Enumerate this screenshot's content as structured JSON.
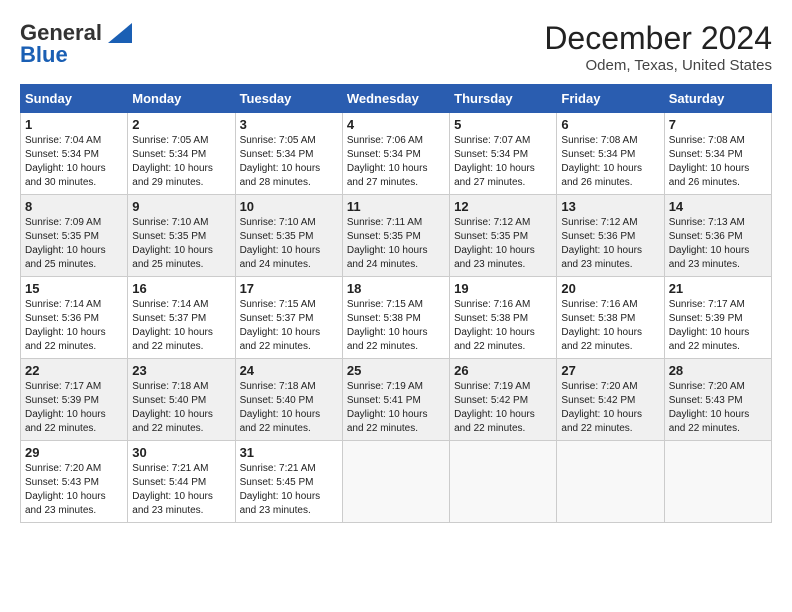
{
  "logo": {
    "line1": "General",
    "line2": "Blue"
  },
  "title": "December 2024",
  "location": "Odem, Texas, United States",
  "days_of_week": [
    "Sunday",
    "Monday",
    "Tuesday",
    "Wednesday",
    "Thursday",
    "Friday",
    "Saturday"
  ],
  "weeks": [
    [
      {
        "day": "1",
        "sunrise": "7:04 AM",
        "sunset": "5:34 PM",
        "daylight": "10 hours and 30 minutes."
      },
      {
        "day": "2",
        "sunrise": "7:05 AM",
        "sunset": "5:34 PM",
        "daylight": "10 hours and 29 minutes."
      },
      {
        "day": "3",
        "sunrise": "7:05 AM",
        "sunset": "5:34 PM",
        "daylight": "10 hours and 28 minutes."
      },
      {
        "day": "4",
        "sunrise": "7:06 AM",
        "sunset": "5:34 PM",
        "daylight": "10 hours and 27 minutes."
      },
      {
        "day": "5",
        "sunrise": "7:07 AM",
        "sunset": "5:34 PM",
        "daylight": "10 hours and 27 minutes."
      },
      {
        "day": "6",
        "sunrise": "7:08 AM",
        "sunset": "5:34 PM",
        "daylight": "10 hours and 26 minutes."
      },
      {
        "day": "7",
        "sunrise": "7:08 AM",
        "sunset": "5:34 PM",
        "daylight": "10 hours and 26 minutes."
      }
    ],
    [
      {
        "day": "8",
        "sunrise": "7:09 AM",
        "sunset": "5:35 PM",
        "daylight": "10 hours and 25 minutes."
      },
      {
        "day": "9",
        "sunrise": "7:10 AM",
        "sunset": "5:35 PM",
        "daylight": "10 hours and 25 minutes."
      },
      {
        "day": "10",
        "sunrise": "7:10 AM",
        "sunset": "5:35 PM",
        "daylight": "10 hours and 24 minutes."
      },
      {
        "day": "11",
        "sunrise": "7:11 AM",
        "sunset": "5:35 PM",
        "daylight": "10 hours and 24 minutes."
      },
      {
        "day": "12",
        "sunrise": "7:12 AM",
        "sunset": "5:35 PM",
        "daylight": "10 hours and 23 minutes."
      },
      {
        "day": "13",
        "sunrise": "7:12 AM",
        "sunset": "5:36 PM",
        "daylight": "10 hours and 23 minutes."
      },
      {
        "day": "14",
        "sunrise": "7:13 AM",
        "sunset": "5:36 PM",
        "daylight": "10 hours and 23 minutes."
      }
    ],
    [
      {
        "day": "15",
        "sunrise": "7:14 AM",
        "sunset": "5:36 PM",
        "daylight": "10 hours and 22 minutes."
      },
      {
        "day": "16",
        "sunrise": "7:14 AM",
        "sunset": "5:37 PM",
        "daylight": "10 hours and 22 minutes."
      },
      {
        "day": "17",
        "sunrise": "7:15 AM",
        "sunset": "5:37 PM",
        "daylight": "10 hours and 22 minutes."
      },
      {
        "day": "18",
        "sunrise": "7:15 AM",
        "sunset": "5:38 PM",
        "daylight": "10 hours and 22 minutes."
      },
      {
        "day": "19",
        "sunrise": "7:16 AM",
        "sunset": "5:38 PM",
        "daylight": "10 hours and 22 minutes."
      },
      {
        "day": "20",
        "sunrise": "7:16 AM",
        "sunset": "5:38 PM",
        "daylight": "10 hours and 22 minutes."
      },
      {
        "day": "21",
        "sunrise": "7:17 AM",
        "sunset": "5:39 PM",
        "daylight": "10 hours and 22 minutes."
      }
    ],
    [
      {
        "day": "22",
        "sunrise": "7:17 AM",
        "sunset": "5:39 PM",
        "daylight": "10 hours and 22 minutes."
      },
      {
        "day": "23",
        "sunrise": "7:18 AM",
        "sunset": "5:40 PM",
        "daylight": "10 hours and 22 minutes."
      },
      {
        "day": "24",
        "sunrise": "7:18 AM",
        "sunset": "5:40 PM",
        "daylight": "10 hours and 22 minutes."
      },
      {
        "day": "25",
        "sunrise": "7:19 AM",
        "sunset": "5:41 PM",
        "daylight": "10 hours and 22 minutes."
      },
      {
        "day": "26",
        "sunrise": "7:19 AM",
        "sunset": "5:42 PM",
        "daylight": "10 hours and 22 minutes."
      },
      {
        "day": "27",
        "sunrise": "7:20 AM",
        "sunset": "5:42 PM",
        "daylight": "10 hours and 22 minutes."
      },
      {
        "day": "28",
        "sunrise": "7:20 AM",
        "sunset": "5:43 PM",
        "daylight": "10 hours and 22 minutes."
      }
    ],
    [
      {
        "day": "29",
        "sunrise": "7:20 AM",
        "sunset": "5:43 PM",
        "daylight": "10 hours and 23 minutes."
      },
      {
        "day": "30",
        "sunrise": "7:21 AM",
        "sunset": "5:44 PM",
        "daylight": "10 hours and 23 minutes."
      },
      {
        "day": "31",
        "sunrise": "7:21 AM",
        "sunset": "5:45 PM",
        "daylight": "10 hours and 23 minutes."
      },
      null,
      null,
      null,
      null
    ]
  ]
}
